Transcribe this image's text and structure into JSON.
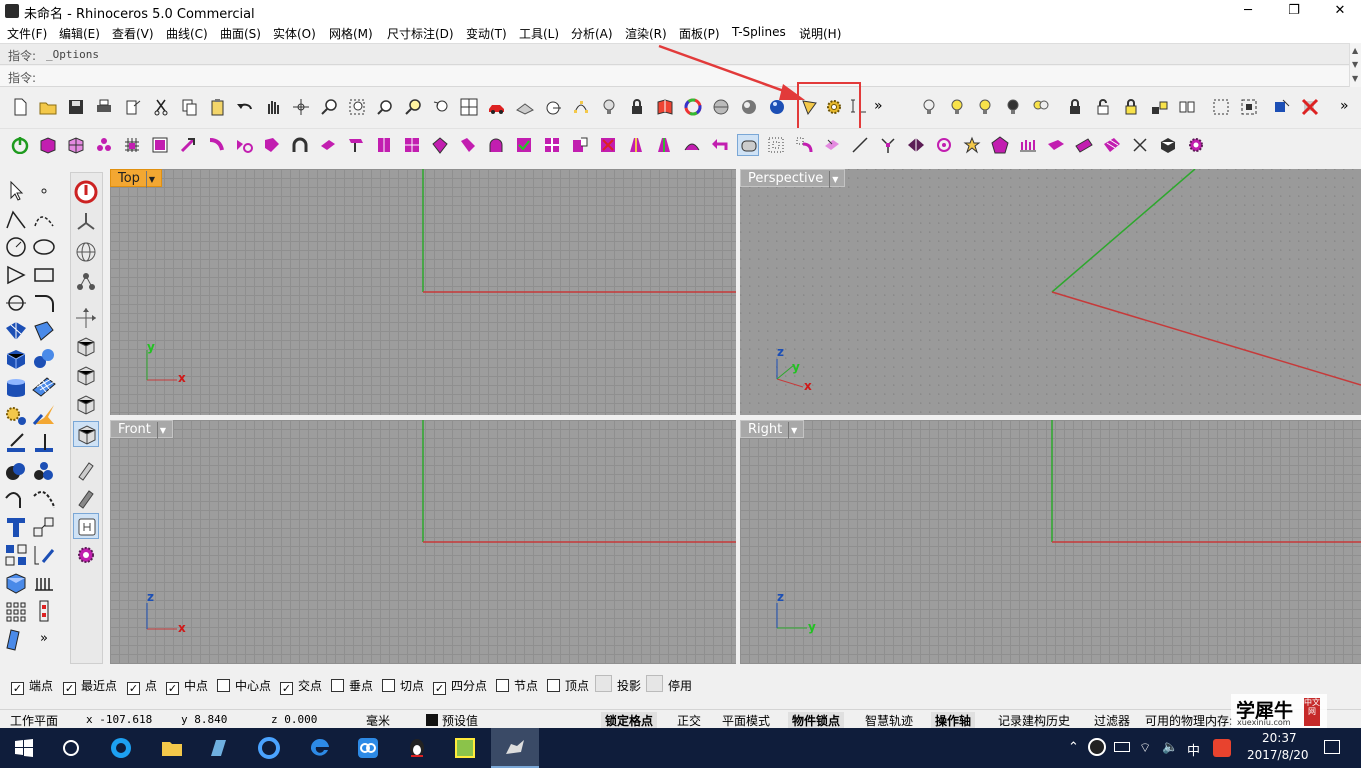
{
  "window": {
    "title": "未命名 - Rhinoceros 5.0 Commercial",
    "minimize": "─",
    "restore": "❐",
    "close": "✕"
  },
  "menu": [
    "文件(F)",
    "编辑(E)",
    "查看(V)",
    "曲线(C)",
    "曲面(S)",
    "实体(O)",
    "网格(M)",
    "尺寸标注(D)",
    "变动(T)",
    "工具(L)",
    "分析(A)",
    "渲染(R)",
    "面板(P)",
    "T-Splines",
    "说明(H)"
  ],
  "command": {
    "history_label": "指令:",
    "history_value": "_Options",
    "prompt_label": "指令:",
    "prompt_value": ""
  },
  "toolbar1_overflow": "»",
  "toolbar1_overflow2": "»",
  "sidebar_overflow": "»",
  "viewports": {
    "top": "Top",
    "perspective": "Perspective",
    "front": "Front",
    "right": "Right"
  },
  "axes": {
    "x": "x",
    "y": "y",
    "z": "z"
  },
  "osnap": [
    {
      "label": "端点",
      "checked": true
    },
    {
      "label": "最近点",
      "checked": true
    },
    {
      "label": "点",
      "checked": true
    },
    {
      "label": "中点",
      "checked": true
    },
    {
      "label": "中心点",
      "checked": false
    },
    {
      "label": "交点",
      "checked": true
    },
    {
      "label": "垂点",
      "checked": false
    },
    {
      "label": "切点",
      "checked": false
    },
    {
      "label": "四分点",
      "checked": true
    },
    {
      "label": "节点",
      "checked": false
    },
    {
      "label": "顶点",
      "checked": false
    },
    {
      "label": "投影",
      "checked": false,
      "disabled": true
    },
    {
      "label": "停用",
      "checked": false,
      "disabled": true
    }
  ],
  "status": {
    "cplane": "工作平面",
    "x": "x -107.618",
    "y": "y 8.840",
    "z": "z 0.000",
    "units": "毫米",
    "layer": "预设值",
    "grid_snap": "锁定格点",
    "ortho": "正交",
    "planar": "平面模式",
    "osnap": "物件锁点",
    "smarttrack": "智慧轨迹",
    "gumball": "操作轴",
    "history": "记录建构历史",
    "filter": "过滤器",
    "memory": "可用的物理内存:"
  },
  "watermark": {
    "text": "学犀牛",
    "sub": "xuexiniu.com",
    "badge": "中文网"
  },
  "taskbar": {
    "ime": "中",
    "time": "20:37",
    "date": "2017/8/20"
  },
  "colors": {
    "x_axis": "#c63a3a",
    "y_axis": "#2da82d",
    "highlight": "#e23a3a",
    "accent": "#f3a732"
  }
}
